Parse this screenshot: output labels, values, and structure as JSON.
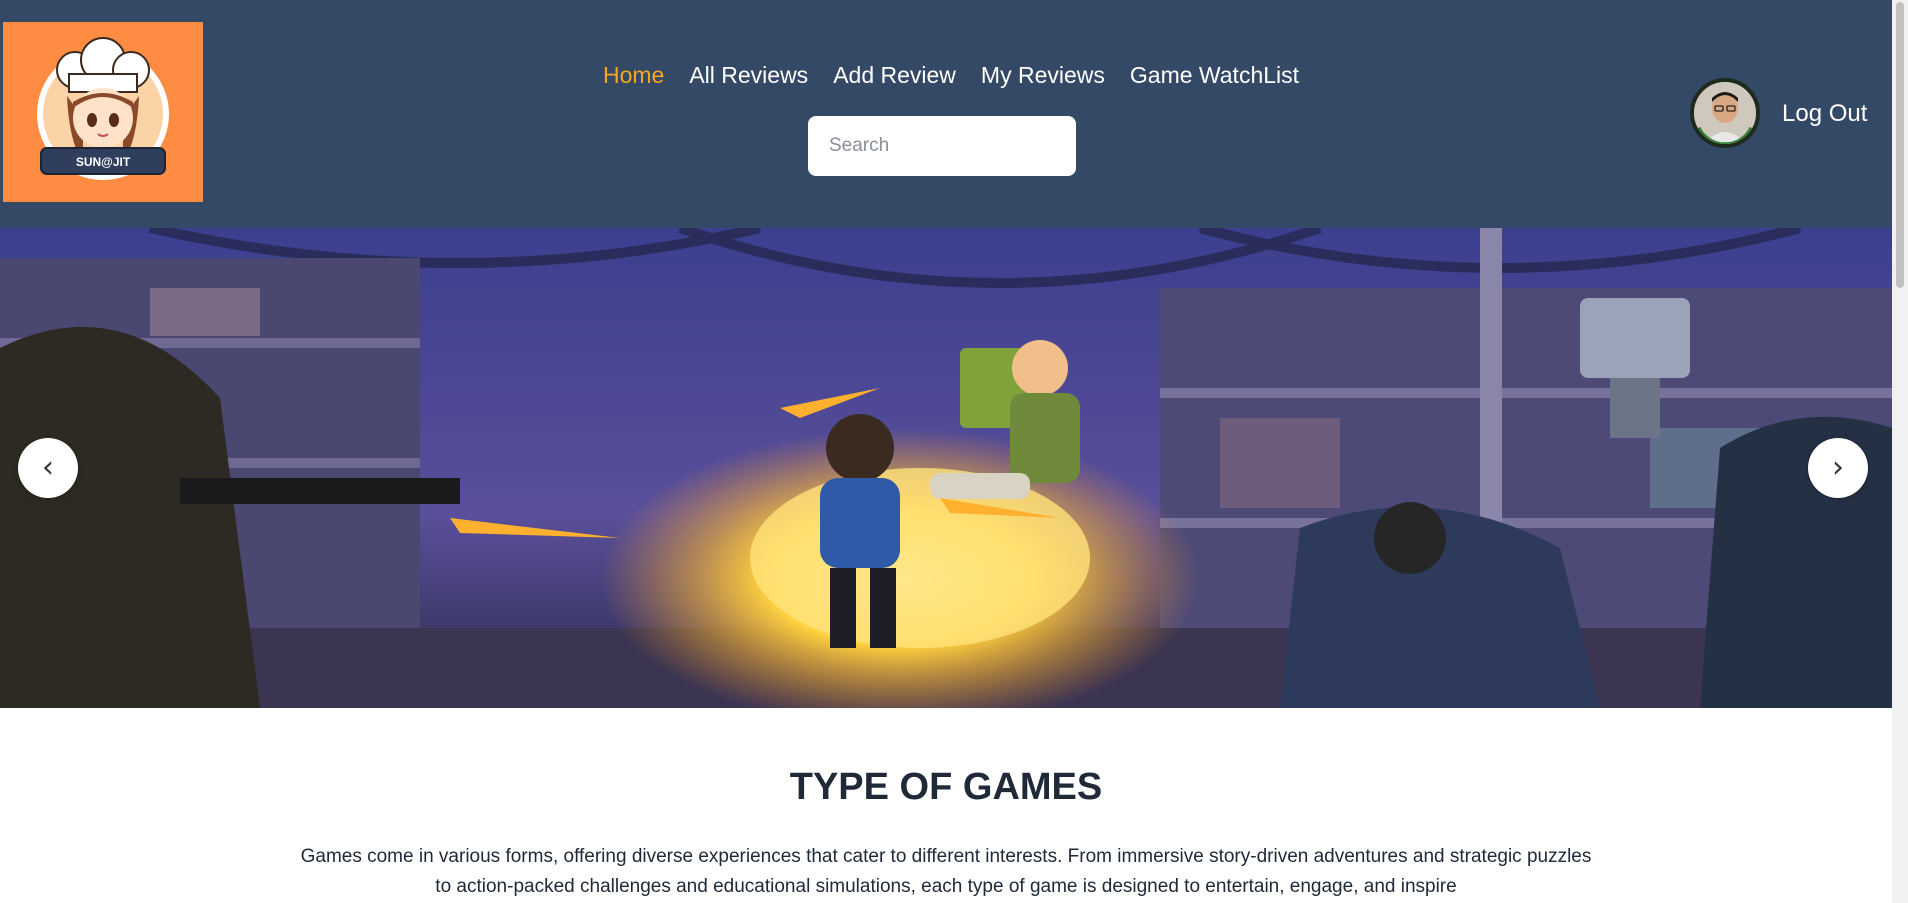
{
  "logo": {
    "text": "SUN@JIT"
  },
  "nav": {
    "items": [
      {
        "label": "Home",
        "active": true
      },
      {
        "label": "All Reviews",
        "active": false
      },
      {
        "label": "Add Review",
        "active": false
      },
      {
        "label": "My Reviews",
        "active": false
      },
      {
        "label": "Game WatchList",
        "active": false
      }
    ]
  },
  "search": {
    "placeholder": "Search",
    "value": ""
  },
  "user": {
    "logout_label": "Log Out"
  },
  "banner": {
    "prev": "‹",
    "next": "›"
  },
  "section": {
    "title": "TYPE OF GAMES",
    "text": "Games come in various forms, offering diverse experiences that cater to different interests. From immersive story-driven adventures and strategic puzzles to action-packed challenges and educational simulations, each type of game is designed to entertain, engage, and inspire"
  },
  "colors": {
    "header_bg": "#344966",
    "accent": "#f5a623",
    "logo_bg": "#ff8c42"
  }
}
